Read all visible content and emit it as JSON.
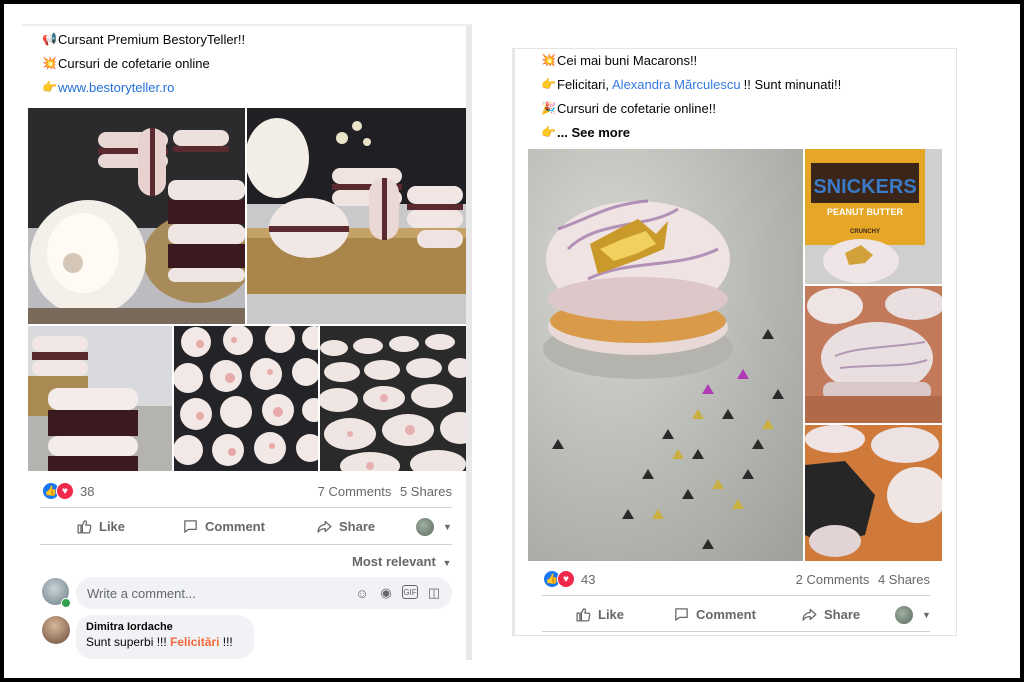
{
  "post1": {
    "lines": [
      {
        "icon": "megaphone-icon",
        "emoji": "📢",
        "text": "Cursant Premium BestoryTeller!!"
      },
      {
        "icon": "sparkle-icon",
        "emoji": "💥",
        "text": "Cursuri de cofetarie online"
      },
      {
        "icon": "pointing-hand-icon",
        "emoji": "👉",
        "text": "www.bestoryteller.ro"
      }
    ],
    "reactions_count": "38",
    "comments_count": "7 Comments",
    "shares_count": "5 Shares",
    "actions": {
      "like": "Like",
      "comment": "Comment",
      "share": "Share"
    },
    "sort_label": "Most relevant",
    "comment_placeholder": "Write a comment...",
    "comment": {
      "author": "Dimitra Iordache",
      "text_prefix": "Sunt superbi !!! ",
      "text_highlight": "Felicitări",
      "text_suffix": " !!!"
    }
  },
  "post2": {
    "line1": {
      "icon": "sparkle-icon",
      "emoji": "💥",
      "text": "Cei mai buni Macarons!!"
    },
    "line2": {
      "icon": "pointing-hand-icon",
      "emoji": "👉",
      "prefix": "Felicitari, ",
      "mention": "Alexandra Mărculescu",
      "suffix": "!! Sunt minunati!!"
    },
    "line3": {
      "icon": "party-icon",
      "emoji": "🎉",
      "text": "Cursuri de cofetarie online!!"
    },
    "line4": {
      "icon": "pointing-hand-icon",
      "emoji": "👉",
      "text": "... See more"
    },
    "jar_label": "SNICKERS",
    "jar_sub1": "PEANUT BUTTER",
    "jar_sub2": "CRUNCHY",
    "reactions_count": "43",
    "comments_count": "2 Comments",
    "shares_count": "4 Shares",
    "actions": {
      "like": "Like",
      "comment": "Comment",
      "share": "Share"
    }
  },
  "colors": {
    "facebook_blue": "#1877f2",
    "love_red": "#f0284a",
    "muted_text": "#65676b",
    "highlight_orange": "#f26a3c"
  }
}
